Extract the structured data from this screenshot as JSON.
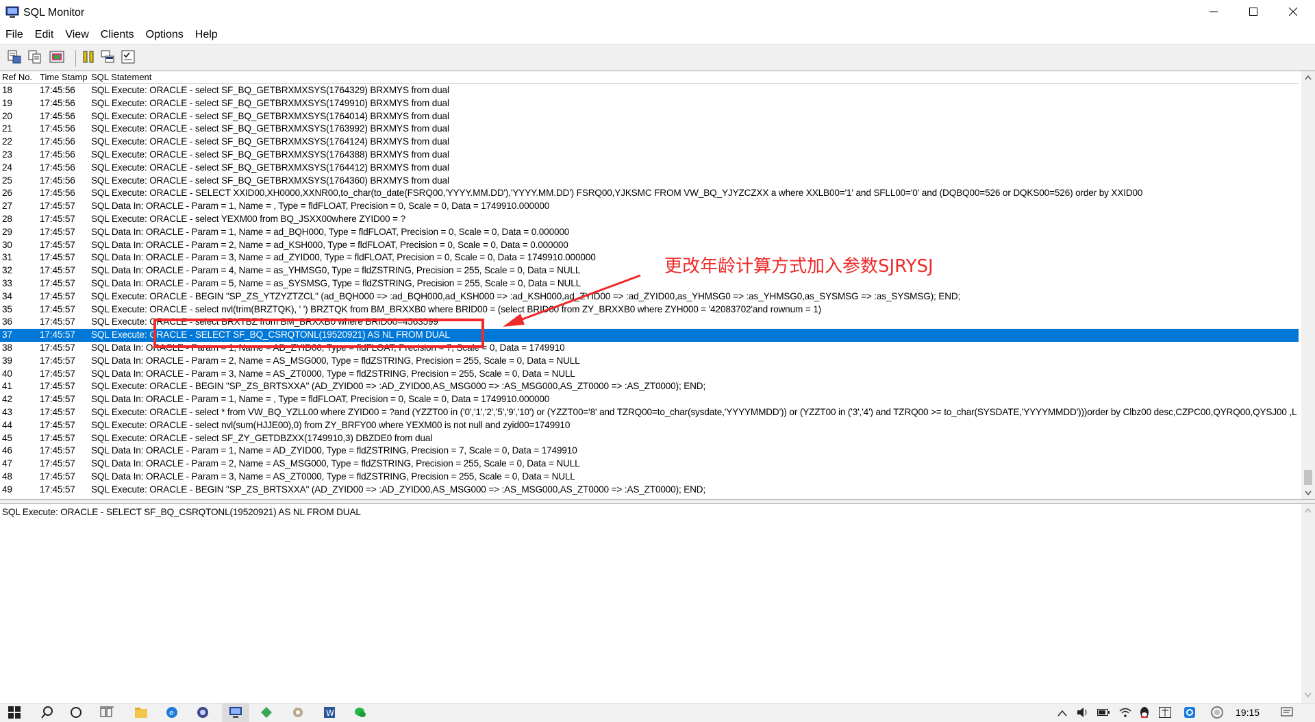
{
  "window": {
    "title": "SQL Monitor",
    "icon": "sql-monitor-icon",
    "controls": [
      "minimize-icon",
      "maximize-icon",
      "close-icon"
    ]
  },
  "menu": [
    "File",
    "Edit",
    "View",
    "Clients",
    "Options",
    "Help"
  ],
  "toolbar": {
    "buttons": [
      "save-log-icon",
      "copy-icon",
      "print-icon",
      "pause-icon",
      "clients-icon",
      "options-checklist-icon"
    ]
  },
  "list": {
    "headers": {
      "ref": "Ref No.",
      "time": "Time Stamp",
      "sql": "SQL Statement"
    },
    "rows": [
      {
        "ref": "18",
        "time": "17:45:56",
        "sql": "SQL Execute: ORACLE -  select SF_BQ_GETBRXMXSYS(1764329) BRXMYS from dual"
      },
      {
        "ref": "19",
        "time": "17:45:56",
        "sql": "SQL Execute: ORACLE -  select SF_BQ_GETBRXMXSYS(1749910) BRXMYS from dual"
      },
      {
        "ref": "20",
        "time": "17:45:56",
        "sql": "SQL Execute: ORACLE -  select SF_BQ_GETBRXMXSYS(1764014) BRXMYS from dual"
      },
      {
        "ref": "21",
        "time": "17:45:56",
        "sql": "SQL Execute: ORACLE -  select SF_BQ_GETBRXMXSYS(1763992) BRXMYS from dual"
      },
      {
        "ref": "22",
        "time": "17:45:56",
        "sql": "SQL Execute: ORACLE -  select SF_BQ_GETBRXMXSYS(1764124) BRXMYS from dual"
      },
      {
        "ref": "23",
        "time": "17:45:56",
        "sql": "SQL Execute: ORACLE -  select SF_BQ_GETBRXMXSYS(1764388) BRXMYS from dual"
      },
      {
        "ref": "24",
        "time": "17:45:56",
        "sql": "SQL Execute: ORACLE -  select SF_BQ_GETBRXMXSYS(1764412) BRXMYS from dual"
      },
      {
        "ref": "25",
        "time": "17:45:56",
        "sql": "SQL Execute: ORACLE -  select SF_BQ_GETBRXMXSYS(1764360) BRXMYS from dual"
      },
      {
        "ref": "26",
        "time": "17:45:56",
        "sql": "SQL Execute: ORACLE -  SELECT XXID00,XH0000,XXNR00,to_char(to_date(FSRQ00,'YYYY.MM.DD'),'YYYY.MM.DD') FSRQ00,YJKSMC FROM VW_BQ_YJYZCZXX a  where XXLB00='1'  and SFLL00='0'   and (DQBQ00=526 or DQKS00=526) order by XXID00"
      },
      {
        "ref": "27",
        "time": "17:45:57",
        "sql": "SQL Data In: ORACLE - Param = 1, Name = , Type = fldFLOAT, Precision = 0, Scale = 0, Data = 1749910.000000"
      },
      {
        "ref": "28",
        "time": "17:45:57",
        "sql": "SQL Execute: ORACLE - select YEXM00 from BQ_JSXX00where ZYID00 = ?"
      },
      {
        "ref": "29",
        "time": "17:45:57",
        "sql": "SQL Data In: ORACLE - Param = 1, Name = ad_BQH000, Type = fldFLOAT, Precision = 0, Scale = 0, Data = 0.000000"
      },
      {
        "ref": "30",
        "time": "17:45:57",
        "sql": "SQL Data In: ORACLE - Param = 2, Name = ad_KSH000, Type = fldFLOAT, Precision = 0, Scale = 0, Data = 0.000000"
      },
      {
        "ref": "31",
        "time": "17:45:57",
        "sql": "SQL Data In: ORACLE - Param = 3, Name = ad_ZYID00, Type = fldFLOAT, Precision = 0, Scale = 0, Data = 1749910.000000"
      },
      {
        "ref": "32",
        "time": "17:45:57",
        "sql": "SQL Data In: ORACLE - Param = 4, Name = as_YHMSG0, Type = fldZSTRING, Precision = 255, Scale = 0, Data = NULL"
      },
      {
        "ref": "33",
        "time": "17:45:57",
        "sql": "SQL Data In: ORACLE - Param = 5, Name = as_SYSMSG, Type = fldZSTRING, Precision = 255, Scale = 0, Data = NULL"
      },
      {
        "ref": "34",
        "time": "17:45:57",
        "sql": "SQL Execute: ORACLE - BEGIN \"SP_ZS_YTZYZTZCL\" (ad_BQH000 => :ad_BQH000,ad_KSH000 => :ad_KSH000,ad_ZYID00 => :ad_ZYID00,as_YHMSG0 => :as_YHMSG0,as_SYSMSG => :as_SYSMSG); END;"
      },
      {
        "ref": "35",
        "time": "17:45:57",
        "sql": "SQL Execute: ORACLE - select nvl(trim(BRZTQK), ' ') BRZTQK from BM_BRXXB0 where BRID00 = (select BRID00 from ZY_BRXXB0 where ZYH000 = '42083702'and rownum = 1)"
      },
      {
        "ref": "36",
        "time": "17:45:57",
        "sql": "SQL Execute: ORACLE - select BRXTBZ from BM_BRXXB0 where BRID00=4563599"
      },
      {
        "ref": "37",
        "time": "17:45:57",
        "sql": "SQL Execute: ORACLE - SELECT  SF_BQ_CSRQTONL(19520921) AS NL FROM DUAL"
      },
      {
        "ref": "38",
        "time": "17:45:57",
        "sql": "SQL Data In: ORACLE - Param = 1, Name = AD_ZYID00, Type = fldFLOAT, Precision = 7, Scale = 0, Data = 1749910"
      },
      {
        "ref": "39",
        "time": "17:45:57",
        "sql": "SQL Data In: ORACLE - Param = 2, Name = AS_MSG000, Type = fldZSTRING, Precision = 255, Scale = 0, Data = NULL"
      },
      {
        "ref": "40",
        "time": "17:45:57",
        "sql": "SQL Data In: ORACLE - Param = 3, Name = AS_ZT0000, Type = fldZSTRING, Precision = 255, Scale = 0, Data = NULL"
      },
      {
        "ref": "41",
        "time": "17:45:57",
        "sql": "SQL Execute: ORACLE - BEGIN \"SP_ZS_BRTSXXA\" (AD_ZYID00 => :AD_ZYID00,AS_MSG000 => :AS_MSG000,AS_ZT0000 => :AS_ZT0000); END;"
      },
      {
        "ref": "42",
        "time": "17:45:57",
        "sql": "SQL Data In: ORACLE - Param = 1, Name = , Type = fldFLOAT, Precision = 0, Scale = 0, Data = 1749910.000000"
      },
      {
        "ref": "43",
        "time": "17:45:57",
        "sql": "SQL Execute: ORACLE - select * from VW_BQ_YZLL00 where ZYID00 = ?and (YZZT00 in ('0','1','2','5','9','10') or (YZZT00='8' and TZRQ00=to_char(sysdate,'YYYYMMDD')) or (YZZT00 in ('3','4') and TZRQ00 >= to_char(SYSDATE,'YYYYMMDD')))order by Clbz00 desc,CZPC00,QYRQ00,QYSJ00 ,L"
      },
      {
        "ref": "44",
        "time": "17:45:57",
        "sql": "SQL Execute: ORACLE - select nvl(sum(HJJE00),0) from ZY_BRFY00  where YEXM00 is not null and zyid00=1749910"
      },
      {
        "ref": "45",
        "time": "17:45:57",
        "sql": "SQL Execute: ORACLE - select SF_ZY_GETDBZXX(1749910,3) DBZDE0 from dual"
      },
      {
        "ref": "46",
        "time": "17:45:57",
        "sql": "SQL Data In: ORACLE - Param = 1, Name = AD_ZYID00, Type = fldZSTRING, Precision = 7, Scale = 0, Data = 1749910"
      },
      {
        "ref": "47",
        "time": "17:45:57",
        "sql": "SQL Data In: ORACLE - Param = 2, Name = AS_MSG000, Type = fldZSTRING, Precision = 255, Scale = 0, Data = NULL"
      },
      {
        "ref": "48",
        "time": "17:45:57",
        "sql": "SQL Data In: ORACLE - Param = 3, Name = AS_ZT0000, Type = fldZSTRING, Precision = 255, Scale = 0, Data = NULL"
      },
      {
        "ref": "49",
        "time": "17:45:57",
        "sql": "SQL Execute: ORACLE - BEGIN \"SP_ZS_BRTSXXA\" (AD_ZYID00 => :AD_ZYID00,AS_MSG000 => :AS_MSG000,AS_ZT0000 => :AS_ZT0000); END;"
      }
    ],
    "selected_ref": "37"
  },
  "detail": {
    "text": "SQL Execute: ORACLE - SELECT  SF_BQ_CSRQTONL(19520921) AS NL FROM DUAL"
  },
  "annotation": {
    "label": "更改年龄计算方式加入参数SJRYSJ",
    "color": "#ee2a2a"
  },
  "taskbar": {
    "apps": [
      "start-icon",
      "search-icon",
      "cortana-icon",
      "task-view-icon",
      "file-explorer-icon",
      "edge-icon",
      "app-globe-icon",
      "sql-monitor-taskbar-icon",
      "app-green-icon",
      "app-gear-icon",
      "word-icon",
      "wechat-icon"
    ],
    "tray": [
      "chevron-up-icon",
      "volume-icon",
      "battery-icon",
      "network-icon",
      "qq-icon",
      "ime-icon",
      "app-tray-icon",
      "assistant-icon"
    ],
    "clock": "19:15"
  },
  "colors": {
    "selection": "#0078d7",
    "annotation": "#ee2a2a"
  }
}
